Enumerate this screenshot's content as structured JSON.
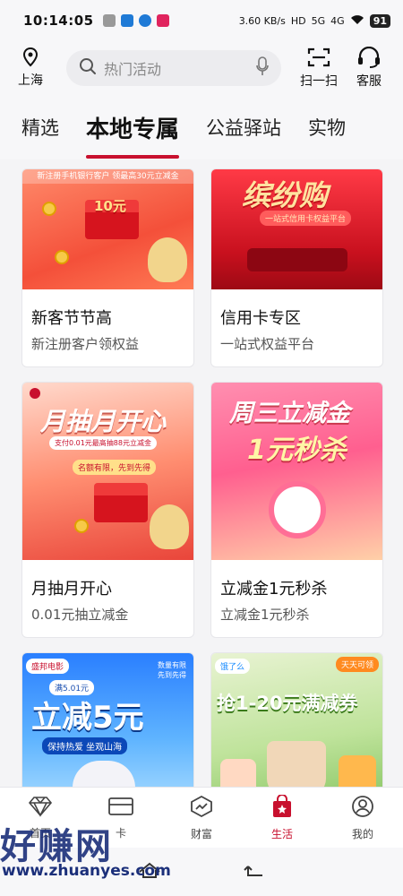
{
  "status_bar": {
    "time": "10:14:05",
    "network_speed": "3.60 KB/s",
    "hd": "HD",
    "signal_1": "5G",
    "signal_2": "4G",
    "battery": "91"
  },
  "header": {
    "location": "上海",
    "search_placeholder": "热门活动",
    "scan_label": "扫一扫",
    "service_label": "客服"
  },
  "tabs": [
    {
      "label": "精选",
      "active": false
    },
    {
      "label": "本地专属",
      "active": true
    },
    {
      "label": "公益驿站",
      "active": false
    },
    {
      "label": "实物",
      "active": false
    }
  ],
  "cards": [
    {
      "title": "新客节节高",
      "subtitle": "新注册客户领权益",
      "banner_top": "新注册手机银行客户 领最高30元立减金",
      "banner_text": "10元"
    },
    {
      "title": "信用卡专区",
      "subtitle": "一站式权益平台",
      "banner_text": "缤纷购",
      "banner_sub": "一站式信用卡权益平台"
    },
    {
      "title": "月抽月开心",
      "subtitle": "0.01元抽立减金",
      "banner_text": "月抽月开心",
      "banner_sub": "支付0.01元最高抽88元立减金",
      "banner_chip": "名额有限，先到先得"
    },
    {
      "title": "立减金1元秒杀",
      "subtitle": "立减金1元秒杀",
      "banner_text": "周三立减金",
      "banner_text2": "1元秒杀"
    },
    {
      "title": "",
      "subtitle": "",
      "banner_brand": "盛邦电影",
      "banner_text": "立减5元",
      "banner_top": "满5.01元",
      "banner_note": "数量有限 先到先得",
      "banner_sub": "保持热爱 坐观山海"
    },
    {
      "title": "",
      "subtitle": "",
      "banner_brand": "饿了么",
      "banner_text": "抢1-20元满减券",
      "banner_note": "天天可领"
    }
  ],
  "bottom_nav": [
    {
      "label": "首页",
      "icon": "diamond-icon",
      "active": false
    },
    {
      "label": "卡",
      "icon": "card-icon",
      "active": false
    },
    {
      "label": "财富",
      "icon": "trend-icon",
      "active": false
    },
    {
      "label": "生活",
      "icon": "shopping-bag-icon",
      "active": true
    },
    {
      "label": "我的",
      "icon": "user-icon",
      "active": false
    }
  ],
  "watermark": {
    "text": "好赚网",
    "url": "www.zhuanyes.com"
  },
  "colors": {
    "accent": "#c8102e",
    "background": "#f4f4f6"
  }
}
